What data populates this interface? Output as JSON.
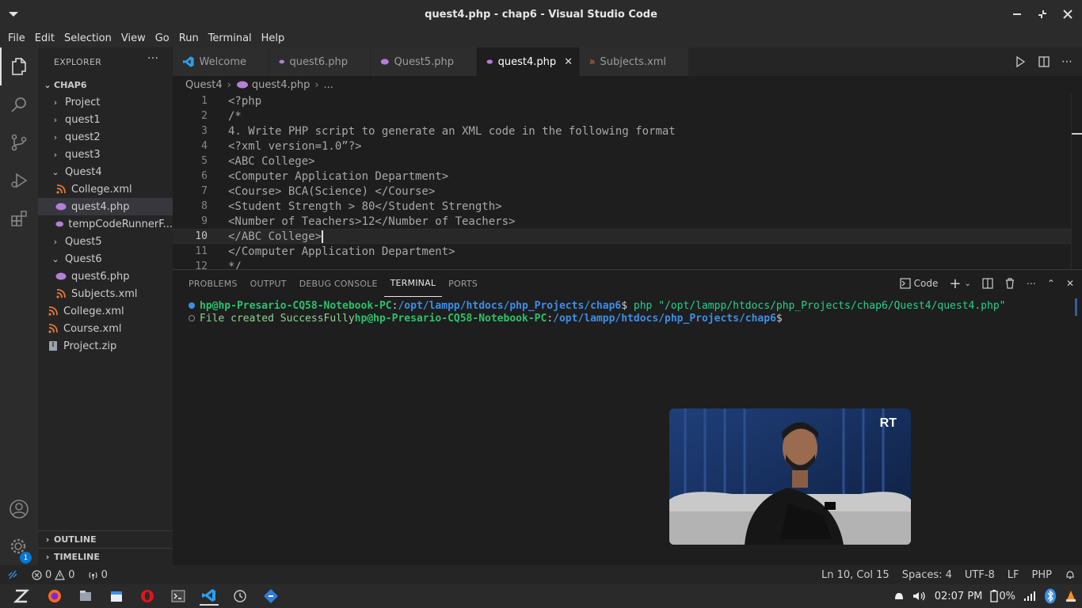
{
  "window": {
    "title": "quest4.php - chap6 - Visual Studio Code"
  },
  "menu": [
    "File",
    "Edit",
    "Selection",
    "View",
    "Go",
    "Run",
    "Terminal",
    "Help"
  ],
  "activity_bar": {
    "items": [
      "explorer-icon",
      "search-icon",
      "source-control-icon",
      "run-debug-icon",
      "extensions-icon"
    ],
    "bottom": [
      "account-icon",
      "manage-gear-icon"
    ],
    "badge": "1"
  },
  "explorer": {
    "header": "EXPLORER",
    "more": "···",
    "root": "CHAP6",
    "items": [
      {
        "label": "Project",
        "type": "folder",
        "open": false,
        "indent": 0
      },
      {
        "label": "quest1",
        "type": "folder",
        "open": false,
        "indent": 0
      },
      {
        "label": "quest2",
        "type": "folder",
        "open": false,
        "indent": 0
      },
      {
        "label": "quest3",
        "type": "folder",
        "open": false,
        "indent": 0
      },
      {
        "label": "Quest4",
        "type": "folder",
        "open": true,
        "indent": 0
      },
      {
        "label": "College.xml",
        "type": "xml",
        "indent": 1
      },
      {
        "label": "quest4.php",
        "type": "php",
        "indent": 1,
        "selected": true
      },
      {
        "label": "tempCodeRunnerF...",
        "type": "php",
        "indent": 1
      },
      {
        "label": "Quest5",
        "type": "folder",
        "open": false,
        "indent": 0
      },
      {
        "label": "Quest6",
        "type": "folder",
        "open": true,
        "indent": 0
      },
      {
        "label": "quest6.php",
        "type": "php",
        "indent": 1
      },
      {
        "label": "Subjects.xml",
        "type": "xml",
        "indent": 1
      },
      {
        "label": "College.xml",
        "type": "xml",
        "indent": 0,
        "file": true
      },
      {
        "label": "Course.xml",
        "type": "xml",
        "indent": 0,
        "file": true
      },
      {
        "label": "Project.zip",
        "type": "zip",
        "indent": 0,
        "file": true
      }
    ],
    "outline": "OUTLINE",
    "timeline": "TIMELINE"
  },
  "tabs": [
    {
      "label": "Welcome",
      "icon": "vscode-icon",
      "active": false
    },
    {
      "label": "quest6.php",
      "icon": "php-icon",
      "active": false
    },
    {
      "label": "Quest5.php",
      "icon": "php-icon",
      "active": false
    },
    {
      "label": "quest4.php",
      "icon": "php-icon",
      "active": true
    },
    {
      "label": "Subjects.xml",
      "icon": "xml-icon",
      "active": false
    }
  ],
  "breadcrumb": {
    "folder": "Quest4",
    "file": "quest4.php",
    "symbol": "..."
  },
  "editor": {
    "current_line": 10,
    "lines": [
      "<?php",
      "/*",
      "4. Write PHP script to generate an XML code in the following format",
      "<?xml version=1.0”?>",
      "<ABC College>",
      "<Computer Application Department>",
      "<Course> BCA(Science) </Course>",
      "<Student Strength > 80</Student Strength>",
      "<Number of Teachers>12</Number of Teachers>",
      "</ABC College>",
      "</Computer Application Department>",
      "*/"
    ]
  },
  "panel": {
    "tabs": [
      "PROBLEMS",
      "OUTPUT",
      "DEBUG CONSOLE",
      "TERMINAL",
      "PORTS"
    ],
    "active_tab": "TERMINAL",
    "terminal_name": "Code",
    "terminal": {
      "line1": {
        "user": "hp@hp-Presario-CQ58-Notebook-PC",
        "colon": ":",
        "path": "/opt/lampp/htdocs/php_Projects/chap6",
        "prompt": "$ ",
        "command": "php \"/opt/lampp/htdocs/php_Projects/chap6/Quest4/quest4.php\""
      },
      "line2": {
        "output": "File created SuccessFully",
        "user": "hp@hp-Presario-CQ58-Notebook-PC",
        "colon": ":",
        "path": "/opt/lampp/htdocs/php_Projects/chap6",
        "prompt": "$"
      }
    }
  },
  "video_overlay": {
    "logo": "RT"
  },
  "status_bar": {
    "errors": "0",
    "warnings": "0",
    "ports": "0",
    "position": "Ln 10, Col 15",
    "spaces": "Spaces: 4",
    "encoding": "UTF-8",
    "eol": "LF",
    "language": "PHP"
  },
  "taskbar": {
    "apps": [
      "zorin-menu-icon",
      "firefox-icon",
      "files-icon",
      "calendar-icon",
      "opera-icon",
      "terminal-icon",
      "vscode-icon",
      "clock-app-icon",
      "app-icon"
    ],
    "clock": "02:07 PM",
    "battery": "0%"
  },
  "colors": {
    "accent": "#3b8eea",
    "php": "#b180d7",
    "xml": "#e37933",
    "status_bg": "#252526"
  }
}
